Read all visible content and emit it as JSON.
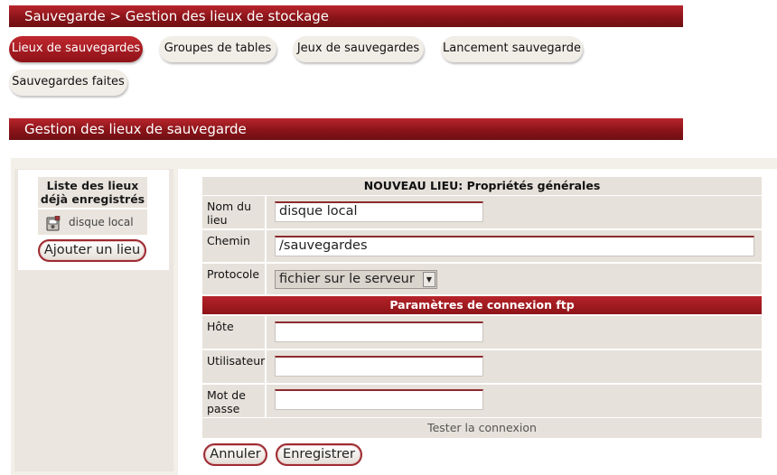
{
  "page": {
    "title": "Sauvegarde > Gestion des lieux de stockage"
  },
  "tabs": [
    {
      "label": "Lieux de sauvegardes",
      "active": true
    },
    {
      "label": "Groupes de tables",
      "active": false
    },
    {
      "label": "Jeux de sauvegardes",
      "active": false
    },
    {
      "label": "Lancement sauvegarde",
      "active": false
    },
    {
      "label": "Sauvegardes faites",
      "active": false
    }
  ],
  "section": {
    "title": "Gestion des lieux de sauvegarde"
  },
  "sidebar": {
    "heading": "Liste des lieux déjà enregistrés",
    "items": [
      {
        "label": "disque local",
        "icon": "local-disk-icon"
      }
    ],
    "add_button": "Ajouter un lieu"
  },
  "form": {
    "general_header": "NOUVEAU LIEU: Propriétés générales",
    "fields": {
      "name": {
        "label": "Nom du lieu",
        "value": "disque local"
      },
      "path": {
        "label": "Chemin",
        "value": "/sauvegardes"
      },
      "protocol": {
        "label": "Protocole",
        "value": "fichier sur le serveur"
      }
    },
    "ftp_header": "Paramètres de connexion ftp",
    "ftp": {
      "host": {
        "label": "Hôte",
        "value": ""
      },
      "user": {
        "label": "Utilisateur",
        "value": ""
      },
      "password": {
        "label": "Mot de passe",
        "value": ""
      }
    },
    "test_label": "Tester la connexion",
    "cancel_button": "Annuler",
    "save_button": "Enregistrer"
  },
  "colors": {
    "accent": "#8a1419",
    "panel": "#ebe6df",
    "cell": "#e6e1da"
  }
}
